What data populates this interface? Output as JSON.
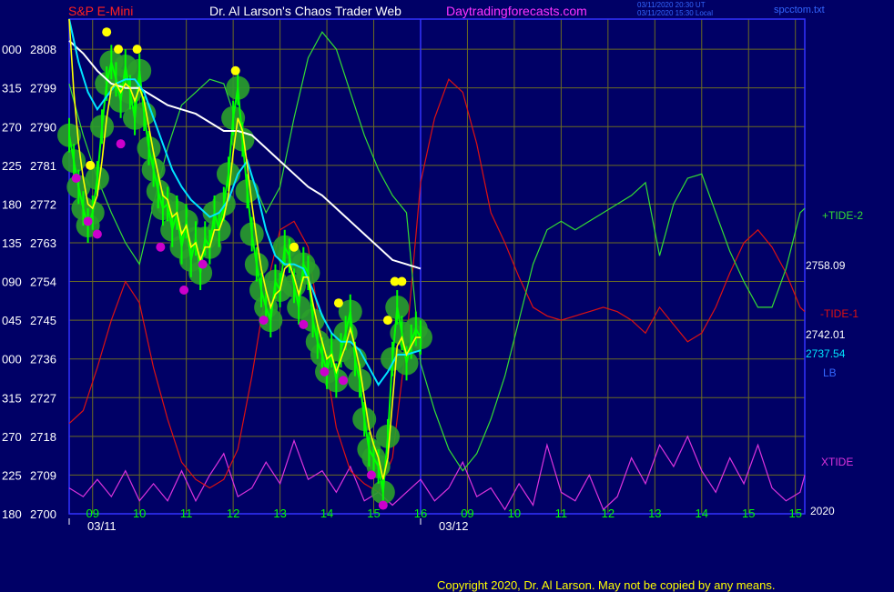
{
  "header": {
    "symbol": "S&P E-Mini",
    "title": "Dr. Al Larson's Chaos Trader Web",
    "site": "Daytradingforecasts.com",
    "file": "spcctom.txt",
    "stamp1": "03/11/2020 20:30 UT",
    "stamp2": "03/11/2020 15:30 Local"
  },
  "copyright": "Copyright 2020, Dr. Al Larson. May not be copied by any means.",
  "colors": {
    "background": "#000066",
    "plot_frame": "#3333ff",
    "grid": "#6b6b22",
    "price_bars": "#00ff00",
    "astro_halo": "#2aa02a",
    "moving_avg": "#ffff00",
    "lb_line": "#00e5ff",
    "ma_long": "#ffffff",
    "tide2": "#33dd33",
    "tide1": "#dd1111",
    "xtide": "#dd33dd",
    "high_marker": "#ffff00",
    "low_marker": "#cc00cc"
  },
  "chart_data": {
    "type": "line",
    "title": "S&P E-Mini",
    "ylim": [
      2700,
      2815
    ],
    "y_ticks": [
      {
        "left": "180",
        "value": 2700
      },
      {
        "left": "225",
        "value": 2709
      },
      {
        "left": "270",
        "value": 2718
      },
      {
        "left": "315",
        "value": 2727
      },
      {
        "left": "000",
        "value": 2736
      },
      {
        "left": "045",
        "value": 2745
      },
      {
        "left": "090",
        "value": 2754
      },
      {
        "left": "135",
        "value": 2763
      },
      {
        "left": "180",
        "value": 2772
      },
      {
        "left": "225",
        "value": 2781
      },
      {
        "left": "270",
        "value": 2790
      },
      {
        "left": "315",
        "value": 2799
      },
      {
        "left": "000",
        "value": 2808
      }
    ],
    "xlim": [
      8.5,
      24.2
    ],
    "now": 16.0,
    "x_ticks": [
      {
        "label": "09",
        "x": 9
      },
      {
        "label": "10",
        "x": 10
      },
      {
        "label": "11",
        "x": 11
      },
      {
        "label": "12",
        "x": 12
      },
      {
        "label": "13",
        "x": 13
      },
      {
        "label": "14",
        "x": 14
      },
      {
        "label": "15",
        "x": 15
      },
      {
        "label": "16",
        "x": 16
      },
      {
        "label": "09",
        "x": 17
      },
      {
        "label": "10",
        "x": 18
      },
      {
        "label": "11",
        "x": 19
      },
      {
        "label": "12",
        "x": 20
      },
      {
        "label": "13",
        "x": 21
      },
      {
        "label": "14",
        "x": 22
      },
      {
        "label": "15",
        "x": 23
      },
      {
        "label": "15",
        "x": 24
      }
    ],
    "dates": [
      {
        "label": "03/11",
        "x": 8.5
      },
      {
        "label": "03/12",
        "x": 16.0
      }
    ],
    "right_labels": {
      "tide2": "+TIDE-2",
      "last_close": "2758.09",
      "tide1": "-TIDE-1",
      "ma_value": "2742.01",
      "lb_value": "2737.54",
      "lb": "LB",
      "xtide": "XTIDE",
      "year": "2020"
    },
    "series": [
      {
        "name": "price",
        "x": [
          8.5,
          8.6,
          8.7,
          8.8,
          8.9,
          9.0,
          9.1,
          9.2,
          9.3,
          9.4,
          9.5,
          9.6,
          9.7,
          9.8,
          9.9,
          10.0,
          10.1,
          10.2,
          10.3,
          10.4,
          10.5,
          10.6,
          10.7,
          10.8,
          10.9,
          11.0,
          11.1,
          11.2,
          11.3,
          11.4,
          11.5,
          11.6,
          11.7,
          11.8,
          11.9,
          12.0,
          12.1,
          12.2,
          12.3,
          12.4,
          12.5,
          12.6,
          12.7,
          12.8,
          12.9,
          13.0,
          13.1,
          13.2,
          13.3,
          13.4,
          13.5,
          13.6,
          13.7,
          13.8,
          13.9,
          14.0,
          14.1,
          14.2,
          14.3,
          14.4,
          14.5,
          14.6,
          14.7,
          14.8,
          14.9,
          15.0,
          15.1,
          15.2,
          15.3,
          15.4,
          15.5,
          15.6,
          15.7,
          15.8,
          15.9,
          16.0
        ],
        "values": [
          2788,
          2782,
          2776,
          2771,
          2767,
          2770,
          2778,
          2790,
          2800,
          2805,
          2801,
          2796,
          2804,
          2798,
          2792,
          2803,
          2793,
          2785,
          2780,
          2775,
          2771,
          2772,
          2766,
          2770,
          2762,
          2768,
          2759,
          2764,
          2756,
          2764,
          2762,
          2770,
          2766,
          2772,
          2779,
          2792,
          2799,
          2787,
          2775,
          2765,
          2758,
          2752,
          2748,
          2745,
          2754,
          2752,
          2762,
          2760,
          2753,
          2748,
          2758,
          2756,
          2745,
          2740,
          2737,
          2733,
          2738,
          2731,
          2738,
          2742,
          2747,
          2736,
          2731,
          2722,
          2715,
          2713,
          2711,
          2705,
          2718,
          2736,
          2748,
          2742,
          2735,
          2740,
          2743,
          2741
        ]
      },
      {
        "name": "ma_fast",
        "x": [
          8.5,
          8.6,
          8.7,
          8.8,
          8.9,
          9.0,
          9.1,
          9.2,
          9.3,
          9.4,
          9.5,
          9.6,
          9.7,
          9.8,
          9.9,
          10.0,
          10.1,
          10.2,
          10.3,
          10.4,
          10.5,
          10.6,
          10.7,
          10.8,
          10.9,
          11.0,
          11.1,
          11.2,
          11.3,
          11.4,
          11.5,
          11.6,
          11.7,
          11.8,
          11.9,
          12.0,
          12.1,
          12.2,
          12.3,
          12.4,
          12.5,
          12.6,
          12.7,
          12.8,
          12.9,
          13.0,
          13.1,
          13.2,
          13.3,
          13.4,
          13.5,
          13.6,
          13.7,
          13.8,
          13.9,
          14.0,
          14.1,
          14.2,
          14.3,
          14.4,
          14.5,
          14.6,
          14.7,
          14.8,
          14.9,
          15.0,
          15.1,
          15.2,
          15.3,
          15.4,
          15.5,
          15.6,
          15.7,
          15.8,
          15.9,
          16.0
        ],
        "values": [
          2815,
          2798,
          2786,
          2778,
          2772,
          2771,
          2774,
          2782,
          2792,
          2799,
          2800,
          2798,
          2800,
          2799,
          2796,
          2799,
          2796,
          2790,
          2784,
          2779,
          2774,
          2773,
          2769,
          2770,
          2765,
          2767,
          2762,
          2763,
          2759,
          2762,
          2762,
          2766,
          2766,
          2769,
          2774,
          2784,
          2792,
          2789,
          2781,
          2772,
          2764,
          2757,
          2752,
          2748,
          2751,
          2752,
          2757,
          2758,
          2755,
          2751,
          2755,
          2755,
          2749,
          2744,
          2740,
          2736,
          2737,
          2733,
          2736,
          2739,
          2743,
          2739,
          2734,
          2727,
          2720,
          2716,
          2713,
          2708,
          2713,
          2726,
          2739,
          2741,
          2737,
          2739,
          2741,
          2741
        ]
      },
      {
        "name": "lb",
        "x": [
          8.5,
          8.7,
          8.9,
          9.1,
          9.3,
          9.5,
          9.7,
          9.9,
          10.1,
          10.3,
          10.5,
          10.7,
          10.9,
          11.1,
          11.3,
          11.5,
          11.7,
          11.9,
          12.1,
          12.3,
          12.5,
          12.7,
          12.9,
          13.1,
          13.3,
          13.5,
          13.7,
          13.9,
          14.1,
          14.3,
          14.5,
          14.7,
          14.9,
          15.1,
          15.3,
          15.5,
          15.7,
          16.0
        ],
        "values": [
          2815,
          2805,
          2798,
          2794,
          2797,
          2800,
          2801,
          2801,
          2798,
          2792,
          2786,
          2780,
          2776,
          2773,
          2771,
          2769,
          2770,
          2773,
          2779,
          2782,
          2775,
          2766,
          2760,
          2758,
          2758,
          2757,
          2752,
          2746,
          2742,
          2740,
          2740,
          2738,
          2734,
          2730,
          2733,
          2737,
          2737,
          2738
        ]
      },
      {
        "name": "ma_long",
        "x": [
          8.5,
          8.8,
          9.1,
          9.4,
          9.7,
          10.0,
          10.3,
          10.6,
          10.9,
          11.2,
          11.5,
          11.8,
          12.1,
          12.4,
          12.7,
          13.0,
          13.3,
          13.6,
          13.9,
          14.2,
          14.5,
          14.8,
          15.1,
          15.4,
          15.7,
          16.0
        ],
        "values": [
          2810,
          2807,
          2803,
          2800,
          2799,
          2799,
          2797,
          2795,
          2794,
          2793,
          2791,
          2789,
          2789,
          2788,
          2785,
          2782,
          2779,
          2776,
          2774,
          2771,
          2768,
          2765,
          2762,
          2759,
          2758,
          2757
        ]
      },
      {
        "name": "+TIDE-2",
        "x": [
          8.5,
          8.8,
          9.1,
          9.4,
          9.7,
          10.0,
          10.3,
          10.6,
          10.9,
          11.2,
          11.5,
          11.8,
          12.1,
          12.4,
          12.7,
          13.0,
          13.3,
          13.6,
          13.9,
          14.2,
          14.5,
          14.8,
          15.1,
          15.4,
          15.7,
          16.0,
          16.3,
          16.6,
          16.9,
          17.2,
          17.5,
          17.8,
          18.1,
          18.4,
          18.7,
          19.0,
          19.3,
          19.6,
          19.9,
          20.2,
          20.5,
          20.8,
          21.1,
          21.4,
          21.7,
          22.0,
          22.3,
          22.6,
          22.9,
          23.2,
          23.5,
          23.8,
          24.1,
          24.2
        ],
        "values": [
          2800,
          2788,
          2778,
          2770,
          2763,
          2758,
          2772,
          2785,
          2795,
          2798,
          2801,
          2800,
          2790,
          2778,
          2770,
          2776,
          2792,
          2806,
          2812,
          2808,
          2798,
          2788,
          2780,
          2774,
          2770,
          2735,
          2724,
          2715,
          2710,
          2714,
          2722,
          2732,
          2745,
          2758,
          2766,
          2768,
          2766,
          2768,
          2770,
          2772,
          2774,
          2777,
          2760,
          2772,
          2778,
          2779,
          2770,
          2761,
          2754,
          2748,
          2748,
          2757,
          2770,
          2771
        ]
      },
      {
        "name": "-TIDE-1",
        "x": [
          8.5,
          8.8,
          9.1,
          9.4,
          9.7,
          10.0,
          10.3,
          10.6,
          10.9,
          11.2,
          11.5,
          11.8,
          12.1,
          12.4,
          12.7,
          13.0,
          13.3,
          13.6,
          13.9,
          14.2,
          14.5,
          14.8,
          15.1,
          15.4,
          15.7,
          16.0,
          16.3,
          16.6,
          16.9,
          17.2,
          17.5,
          17.8,
          18.1,
          18.4,
          18.7,
          19.0,
          19.3,
          19.6,
          19.9,
          20.2,
          20.5,
          20.8,
          21.1,
          21.4,
          21.7,
          22.0,
          22.3,
          22.6,
          22.9,
          23.2,
          23.5,
          23.8,
          24.1,
          24.2
        ],
        "values": [
          2721,
          2724,
          2734,
          2745,
          2754,
          2749,
          2734,
          2722,
          2712,
          2708,
          2706,
          2708,
          2715,
          2732,
          2752,
          2766,
          2768,
          2762,
          2740,
          2720,
          2710,
          2707,
          2705,
          2713,
          2740,
          2777,
          2792,
          2801,
          2798,
          2786,
          2770,
          2763,
          2755,
          2748,
          2746,
          2745,
          2746,
          2747,
          2748,
          2747,
          2745,
          2742,
          2748,
          2744,
          2740,
          2742,
          2748,
          2756,
          2763,
          2766,
          2762,
          2756,
          2748,
          2747
        ]
      },
      {
        "name": "XTIDE",
        "x": [
          8.5,
          8.8,
          9.1,
          9.4,
          9.7,
          10.0,
          10.3,
          10.6,
          10.9,
          11.2,
          11.5,
          11.8,
          12.1,
          12.4,
          12.7,
          13.0,
          13.3,
          13.6,
          13.9,
          14.2,
          14.5,
          14.8,
          15.1,
          15.4,
          15.7,
          16.0,
          16.3,
          16.6,
          16.9,
          17.2,
          17.5,
          17.8,
          18.1,
          18.4,
          18.7,
          19.0,
          19.3,
          19.6,
          19.9,
          20.2,
          20.5,
          20.8,
          21.1,
          21.4,
          21.7,
          22.0,
          22.3,
          22.6,
          22.9,
          23.2,
          23.5,
          23.8,
          24.1,
          24.2
        ],
        "values": [
          2706,
          2704,
          2708,
          2704,
          2710,
          2703,
          2707,
          2703,
          2710,
          2703,
          2709,
          2714,
          2704,
          2706,
          2712,
          2707,
          2717,
          2708,
          2710,
          2705,
          2711,
          2703,
          2705,
          2702,
          2705,
          2708,
          2703,
          2706,
          2712,
          2704,
          2706,
          2701,
          2707,
          2702,
          2716,
          2705,
          2703,
          2709,
          2701,
          2704,
          2713,
          2707,
          2716,
          2711,
          2718,
          2710,
          2705,
          2713,
          2707,
          2716,
          2706,
          2703,
          2705,
          2709
        ]
      }
    ],
    "high_markers": {
      "x": [
        8.95,
        9.3,
        9.55,
        9.95,
        12.05,
        13.3,
        14.25,
        15.3,
        15.45,
        15.6
      ],
      "values": [
        2781,
        2812,
        2808,
        2808,
        2803,
        2762,
        2749,
        2745,
        2754,
        2754
      ]
    },
    "low_markers": {
      "x": [
        8.65,
        8.9,
        9.1,
        9.6,
        10.45,
        10.95,
        11.35,
        12.65,
        13.5,
        13.95,
        14.35,
        14.95,
        15.2
      ],
      "values": [
        2778,
        2768,
        2765,
        2786,
        2762,
        2752,
        2758,
        2745,
        2744,
        2733,
        2731,
        2709,
        2702
      ]
    }
  }
}
